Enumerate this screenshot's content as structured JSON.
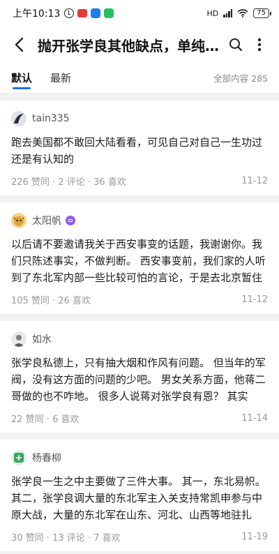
{
  "status": {
    "time": "上午10:13",
    "battery": "75",
    "network": "HD"
  },
  "header": {
    "title": "抛开张学良其他缺点，单纯说私德方面有何问题？"
  },
  "tabs": [
    {
      "label": "默认"
    },
    {
      "label": "最新"
    }
  ],
  "total": "全部内容 285",
  "answers": [
    {
      "author": "tain335",
      "content": "跑去美国都不敢回大陆看看，可见自己对自己一生功过还是有认知的",
      "meta": "226 赞同 · 2 评论 · 36 喜欢",
      "date": "11-12"
    },
    {
      "author": "太阳帆",
      "content": "以后请不要邀请我关于西安事变的话题，我谢谢你。我们只陈述事实，不做判断。 西安事变前，我们家的人听到了东北军内部一些比较可怕的言论，于是去北京暂住",
      "meta": "105 赞同 · 26 喜欢",
      "date": "11-12"
    },
    {
      "author": "如水",
      "content": "张学良私德上，只有抽大烟和作风有问题。 但当年的军阀，没有这方面的问题的少吧。 男女关系方面，他蒋二哥做的也不咋地。 很多人说蒋对张学良有恩？ 其实",
      "meta": "22 赞同 · 6 喜欢",
      "date": "11-14"
    },
    {
      "author": "杨春柳",
      "content": "张学良一生之中主要做了三件大事。 其一，东北易帜。 其二，张学良调大量的东北军主入关支持常凯申参与中原大战，大量的东北军在山东、河北、山西等地驻扎",
      "meta": "30 赞同 · 13 评论 · 7 喜欢",
      "date": "11-19"
    }
  ]
}
